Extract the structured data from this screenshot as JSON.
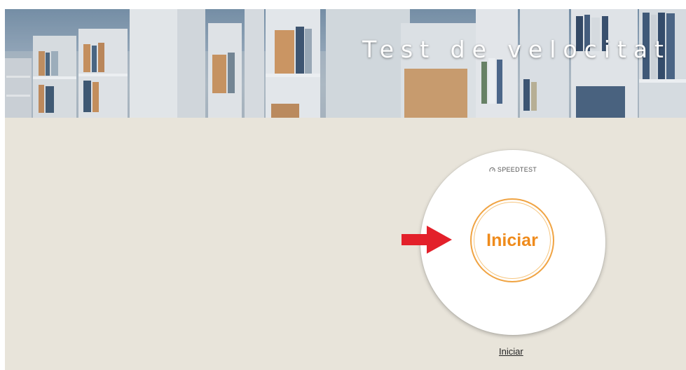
{
  "banner": {
    "title": "Test de velocitat"
  },
  "speedtest": {
    "brand": "SPEEDTEST",
    "go_label": "Iniciar",
    "accent_color": "#ef8b1c"
  },
  "link": {
    "label": "Iniciar"
  },
  "colors": {
    "page_background": "#e8e4da",
    "arrow": "#e3202a"
  },
  "icons": [
    "speedometer-icon",
    "arrow-right-icon"
  ]
}
